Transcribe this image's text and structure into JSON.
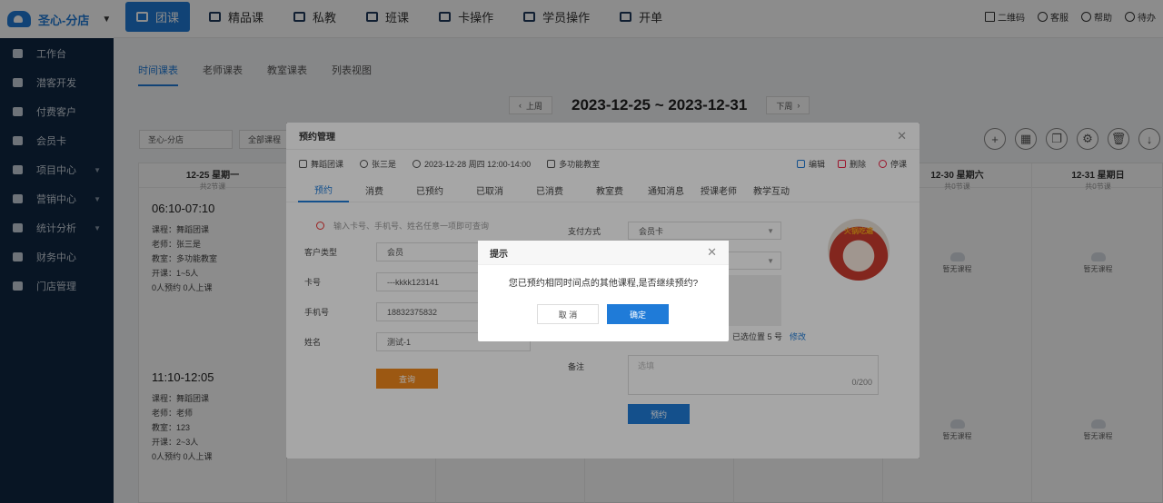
{
  "brand": {
    "name": "圣心-分店"
  },
  "nav": {
    "tabs": [
      "团课",
      "精品课",
      "私教",
      "班课",
      "卡操作",
      "学员操作",
      "开单"
    ]
  },
  "top_right": [
    "二维码",
    "客服",
    "帮助",
    "待办"
  ],
  "sidebar": {
    "items": [
      "工作台",
      "潜客开发",
      "付费客户",
      "会员卡",
      "项目中心",
      "营销中心",
      "统计分析",
      "财务中心",
      "门店管理"
    ]
  },
  "subtabs": [
    "时间课表",
    "老师课表",
    "教室课表",
    "列表视图"
  ],
  "week": {
    "prev": "上周",
    "title": "2023-12-25 ~ 2023-12-31",
    "next": "下周"
  },
  "filters": {
    "store": "圣心-分店",
    "course": "全部课程"
  },
  "days": [
    {
      "date": "12-25 星期一",
      "count": "共2节课"
    },
    {
      "date": "12-30 星期六",
      "count": "共0节课"
    },
    {
      "date": "12-31 星期日",
      "count": "共0节课"
    }
  ],
  "sessions": [
    {
      "time": "06:10-07:10",
      "course": "课程：舞蹈团课",
      "teacher": "老师：张三是",
      "room": "教室：多功能教室",
      "open": "开课：1~5人",
      "status": "0人预约 0人上课"
    },
    {
      "time": "11:10-12:05",
      "course": "课程：舞蹈团课",
      "teacher": "老师：老师",
      "room": "教室：123",
      "open": "开课：2~3人",
      "status": "0人预约 0人上课"
    }
  ],
  "empty_label": "暂无课程",
  "modal": {
    "title": "预约管理",
    "info": {
      "course": "舞蹈团课",
      "teacher": "张三是",
      "datetime": "2023-12-28 周四 12:00-14:00",
      "room": "多功能教室"
    },
    "actions": [
      "编辑",
      "删除",
      "停课"
    ],
    "tabs": [
      "预约",
      "消费",
      "已预约",
      "已取消",
      "已消费",
      "教室费",
      "通知消息",
      "授课老师",
      "教学互动"
    ],
    "hint": "输入卡号、手机号、姓名任意一项即可查询",
    "fields": [
      {
        "label": "客户类型",
        "value": "会员"
      },
      {
        "label": "卡号",
        "value": "---kkkk123141"
      },
      {
        "label": "手机号",
        "value": "18832375832"
      },
      {
        "label": "姓名",
        "value": "测试-1"
      }
    ],
    "query_btn": "查询",
    "pay_label": "支付方式",
    "pay_value": "会员卡",
    "seat_text": "已选位置 5 号",
    "seat_link": "修改",
    "remark_label": "备注",
    "remark_placeholder": "选填",
    "remark_count": "0/200",
    "book_btn": "预约",
    "avatar_caption": "火锅吃遍"
  },
  "dialog": {
    "title": "提示",
    "message": "您已预约相同时间点的其他课程,是否继续预约?",
    "cancel": "取 消",
    "ok": "确定"
  }
}
